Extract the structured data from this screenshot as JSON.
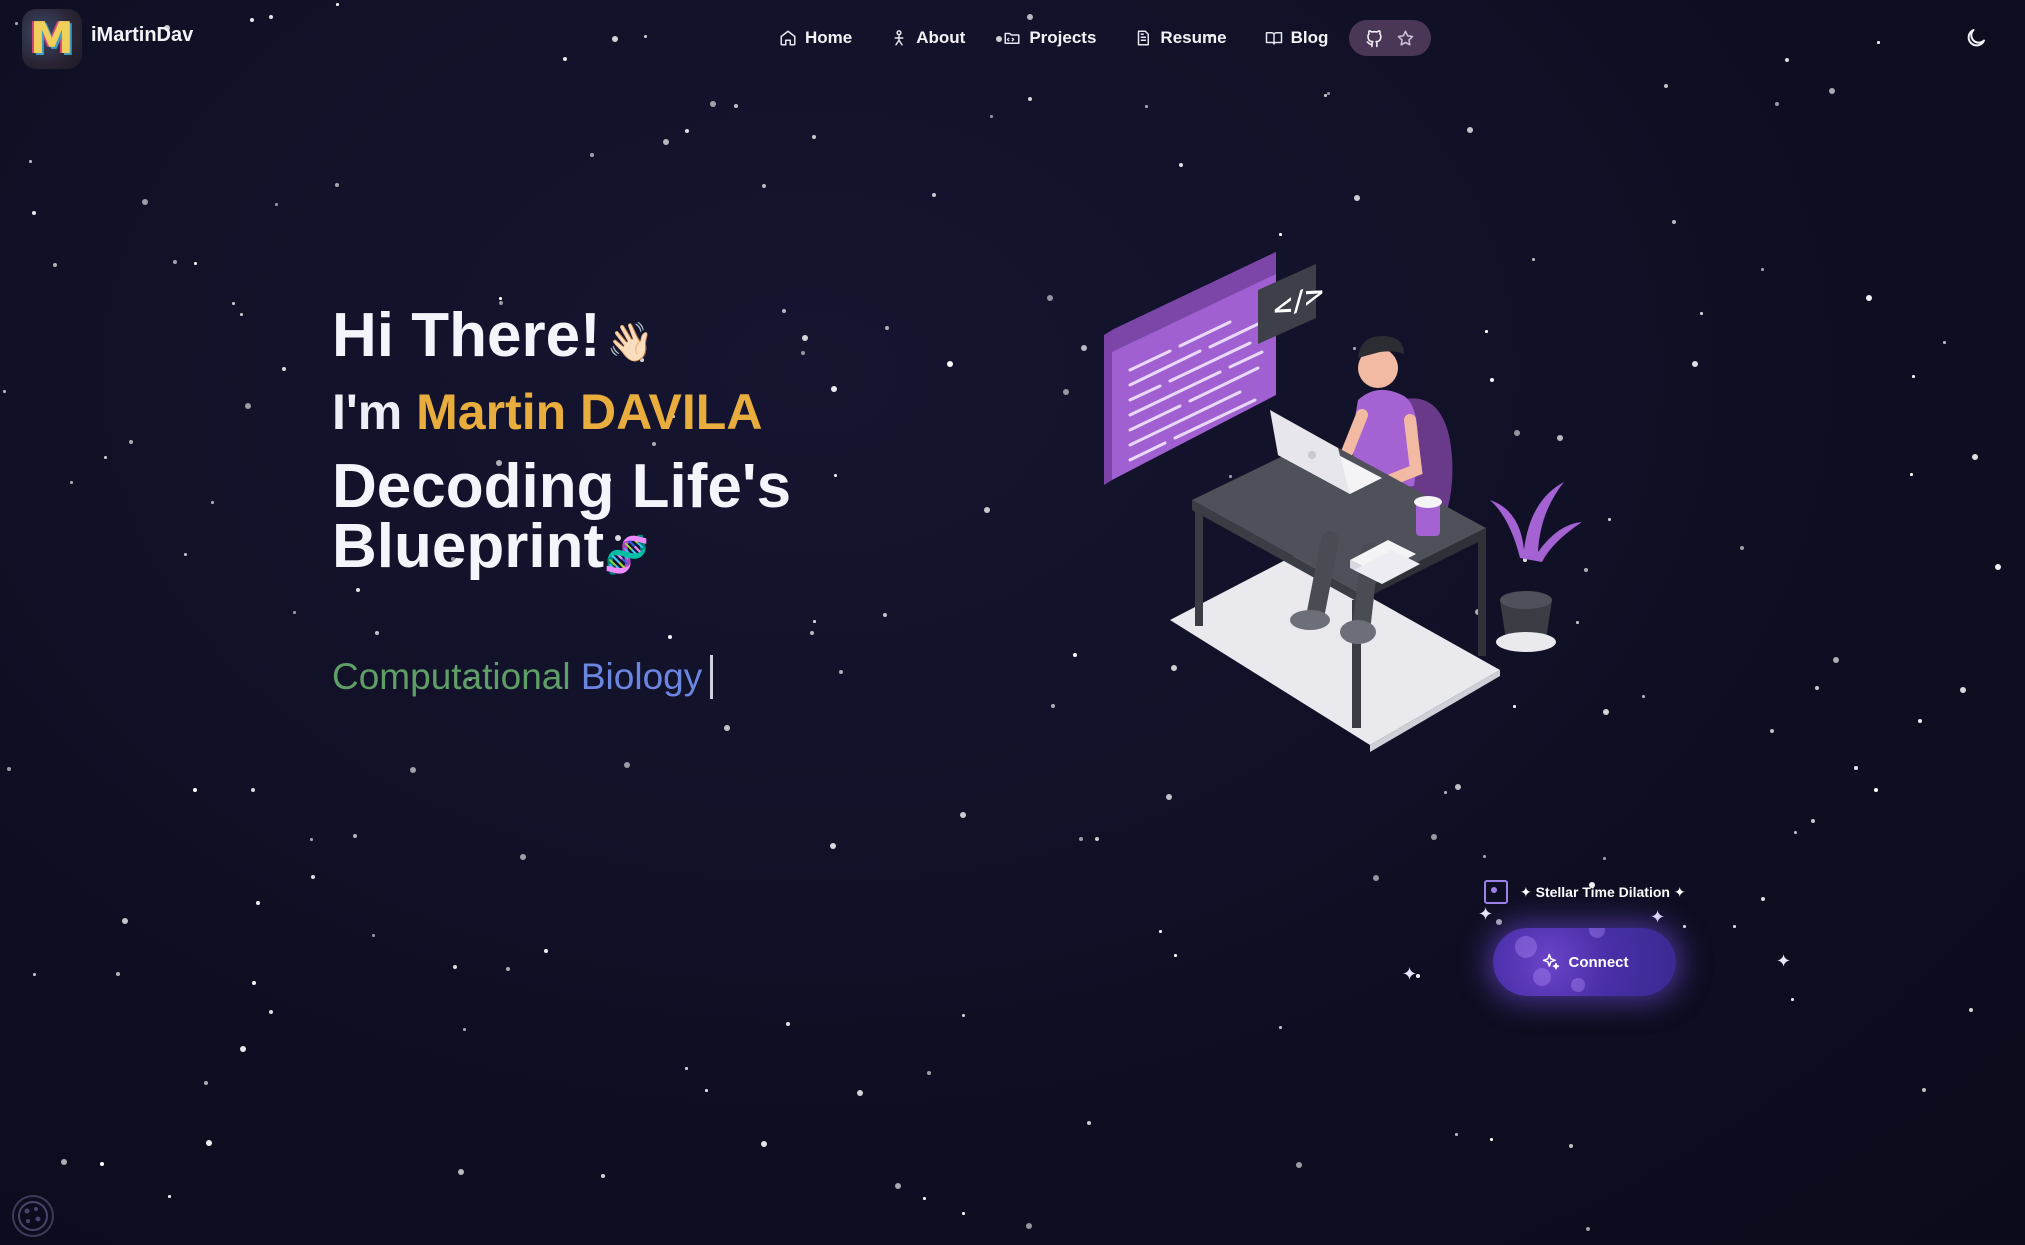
{
  "nav": {
    "brand": "iMartinDav",
    "logo_letter": "M",
    "items": [
      {
        "label": "Home",
        "icon": "home-icon"
      },
      {
        "label": "About",
        "icon": "person-icon"
      },
      {
        "label": "Projects",
        "icon": "folder-icon"
      },
      {
        "label": "Resume",
        "icon": "document-icon"
      },
      {
        "label": "Blog",
        "icon": "book-icon"
      }
    ],
    "github_icon": "github-icon",
    "star_icon": "star-icon",
    "theme_icon": "moon-icon"
  },
  "hero": {
    "greeting": "Hi There!",
    "wave_emoji": "👋🏻",
    "intro_prefix": "I'm ",
    "name": "Martin DAVILA",
    "tagline": "Decoding Life's Blueprint",
    "dna_emoji": "🧬",
    "typed_word1": "Computational",
    "typed_word2": "Biology"
  },
  "connect": {
    "toggle_label": "✦ Stellar Time Dilation ✦",
    "button_label": "Connect",
    "button_icon": "sparkles-icon"
  },
  "colors": {
    "background": "#0f0f24",
    "accent_name": "#e8ad3c",
    "typed_green": "#5f9e67",
    "typed_blue": "#6b86e0",
    "button_purple": "#4a2fa8"
  },
  "cookie_icon": "cookie-icon"
}
